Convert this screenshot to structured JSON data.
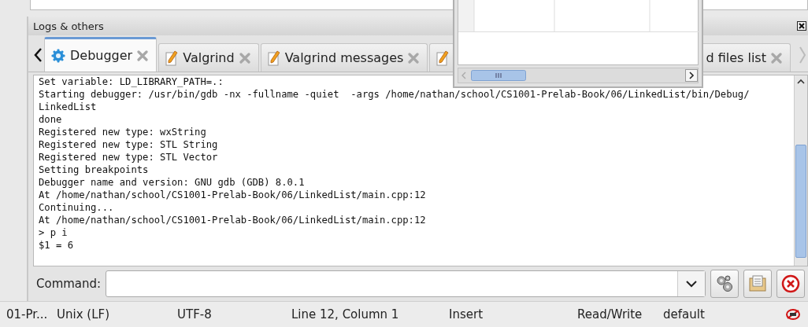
{
  "panel": {
    "title": "Logs & others"
  },
  "tabs": [
    {
      "label": "Debugger",
      "kind": "debugger",
      "selected": true
    },
    {
      "label": "Valgrind",
      "kind": "log",
      "selected": false
    },
    {
      "label": "Valgrind messages",
      "kind": "log",
      "selected": false
    },
    {
      "kind": "log",
      "selected": false
    },
    {
      "label": "d files list",
      "selected": false
    }
  ],
  "log": {
    "lines": [
      "Set variable: LD_LIBRARY_PATH=.:",
      "Starting debugger: /usr/bin/gdb -nx -fullname -quiet  -args /home/nathan/school/CS1001-Prelab-Book/06/LinkedList/bin/Debug/",
      "LinkedList",
      "done",
      "Registered new type: wxString",
      "Registered new type: STL String",
      "Registered new type: STL Vector",
      "Setting breakpoints",
      "Debugger name and version: GNU gdb (GDB) 8.0.1",
      "At /home/nathan/school/CS1001-Prelab-Book/06/LinkedList/main.cpp:12",
      "Continuing...",
      "At /home/nathan/school/CS1001-Prelab-Book/06/LinkedList/main.cpp:12",
      "> p i",
      "$1 = 6"
    ]
  },
  "command": {
    "label": "Command:"
  },
  "status_bar": {
    "items": [
      "01-Pr...",
      "Unix (LF)",
      "UTF-8",
      "Line 12, Column 1",
      "Insert",
      "Read/Write",
      "default"
    ]
  }
}
